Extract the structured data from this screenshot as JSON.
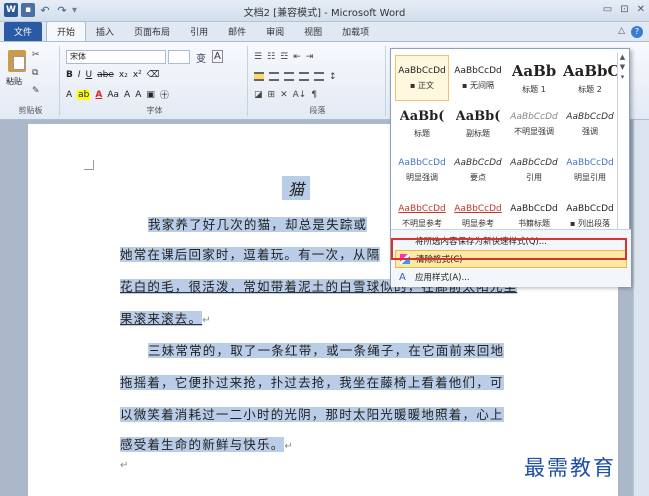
{
  "window": {
    "title": "文档2 [兼容模式] - Microsoft Word",
    "controls": [
      "▭",
      "⊡",
      "✕"
    ]
  },
  "qat": {
    "app": "W",
    "undo": "↶",
    "redo": "↷"
  },
  "tabs": [
    "文件",
    "开始",
    "插入",
    "页面布局",
    "引用",
    "邮件",
    "审阅",
    "视图",
    "加载项"
  ],
  "ribbon": {
    "clipboard": {
      "paste": "粘贴",
      "group": "剪贴板"
    },
    "font": {
      "name": "宋体",
      "size": "",
      "group": "字体",
      "row1": [
        "B",
        "I",
        "U",
        "abe",
        "x₂",
        "x²"
      ],
      "row2_extra": [
        "Aa",
        "A",
        "A"
      ]
    },
    "paragraph": {
      "group": "段落",
      "row3": [
        "A↓",
        "¶"
      ]
    }
  },
  "gallery": {
    "styles": [
      {
        "sample": "AaBbCcDd",
        "name": "▪ 正文",
        "cls": "on"
      },
      {
        "sample": "AaBbCcDd",
        "name": "▪ 无间隔",
        "cls": ""
      },
      {
        "sample": "AaBb",
        "name": "标题 1",
        "cls": "big"
      },
      {
        "sample": "AaBbC",
        "name": "标题 2",
        "cls": "big"
      },
      {
        "sample": "AaBb(",
        "name": "标题",
        "cls": "mid"
      },
      {
        "sample": "AaBb(",
        "name": "副标题",
        "cls": "mid"
      },
      {
        "sample": "AaBbCcDd",
        "name": "不明显强调",
        "cls": "grey"
      },
      {
        "sample": "AaBbCcDd",
        "name": "强调",
        "cls": "ital"
      },
      {
        "sample": "AaBbCcDd",
        "name": "明显强调",
        "cls": "blue"
      },
      {
        "sample": "AaBbCcDd",
        "name": "要点",
        "cls": "ital"
      },
      {
        "sample": "AaBbCcDd",
        "name": "引用",
        "cls": "ital"
      },
      {
        "sample": "AaBbCcDd",
        "name": "明显引用",
        "cls": "blue"
      },
      {
        "sample": "AaBbCcDd",
        "name": "不明显参考",
        "cls": "red"
      },
      {
        "sample": "AaBbCcDd",
        "name": "明显参考",
        "cls": "red"
      },
      {
        "sample": "AaBbCcDd",
        "name": "书籍标题",
        "cls": ""
      },
      {
        "sample": "AaBbCcDd",
        "name": "▪ 列出段落",
        "cls": ""
      }
    ],
    "menu": {
      "save_selection": "将所选内容保存为新快速样式(Q)...",
      "clear_formatting": "清除格式(C)",
      "apply_styles": "应用样式(A)..."
    }
  },
  "document": {
    "title": "猫",
    "lines": [
      "我家养了好几次的猫，却总是失踪或",
      "她常在课后回家时，逗着玩。有一次，从隔",
      "花白的毛，很活泼，常如带着泥土的白雪球似的，在廊前太阳光里",
      "果滚来滚去。",
      "三妹常常的，取了一条红带，或一条绳子，在它面前来回地",
      "拖摇着，它便扑过来抢，扑过去抢，我坐在藤椅上看着他们，可",
      "以微笑着消耗过一二小时的光阴，那时太阳光暖暖地照着，心上",
      "感受着生命的新鲜与快乐。"
    ]
  },
  "watermark": "最需教育"
}
